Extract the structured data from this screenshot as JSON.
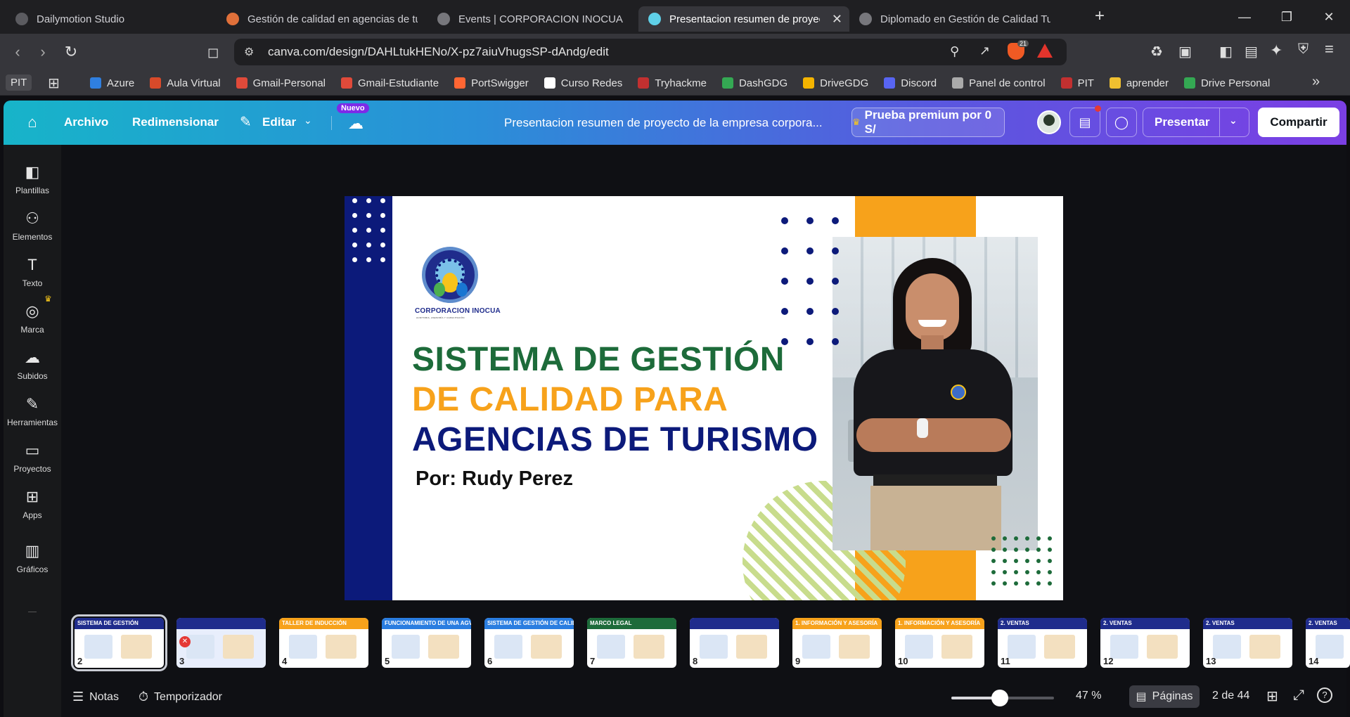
{
  "tabs": [
    {
      "title": "Dailymotion Studio",
      "color": "#5b5b60"
    },
    {
      "title": "Gestión de calidad en agencias de tur",
      "color": "#e0703a"
    },
    {
      "title": "Events | CORPORACION INOCUA",
      "color": "#77777c"
    },
    {
      "title": "Presentacion resumen de proyec",
      "color": "#5fd0e8",
      "active": true
    },
    {
      "title": "Diplomado en Gestión de Calidad Tur",
      "color": "#77777c"
    }
  ],
  "url": "canva.com/design/DAHLtukHENo/X-pz7aiuVhugsSP-dAndg/edit",
  "brave_badge": "21",
  "bookmarks": [
    {
      "label": "PIT",
      "color": "#4a4a4f"
    },
    {
      "label": "Azure",
      "color": "#2f7fe0"
    },
    {
      "label": "Aula Virtual",
      "color": "#d84a2a"
    },
    {
      "label": "Gmail-Personal",
      "color": "#e04a3a"
    },
    {
      "label": "Gmail-Estudiante",
      "color": "#e04a3a"
    },
    {
      "label": "PortSwigger",
      "color": "#ff6633"
    },
    {
      "label": "Curso Redes",
      "color": "#ffffff"
    },
    {
      "label": "Tryhackme",
      "color": "#c23030"
    },
    {
      "label": "DashGDG",
      "color": "#34a853"
    },
    {
      "label": "DriveGDG",
      "color": "#f4b400"
    },
    {
      "label": "Discord",
      "color": "#5865f2"
    },
    {
      "label": "Panel de control",
      "color": "#aaaaaa"
    },
    {
      "label": "PIT",
      "color": "#c23030"
    },
    {
      "label": "aprender",
      "color": "#f0c030"
    },
    {
      "label": "Drive Personal",
      "color": "#34a853"
    }
  ],
  "header": {
    "archivo": "Archivo",
    "redimensionar": "Redimensionar",
    "editar": "Editar",
    "nuevo": "Nuevo",
    "doc_title": "Presentacion resumen de proyecto de la empresa corpora...",
    "premium": "Prueba premium por 0 S/",
    "presentar": "Presentar",
    "compartir": "Compartir"
  },
  "sidebar": [
    {
      "label": "Plantillas",
      "icon": "◧"
    },
    {
      "label": "Elementos",
      "icon": "⚇"
    },
    {
      "label": "Texto",
      "icon": "T"
    },
    {
      "label": "Marca",
      "icon": "◎"
    },
    {
      "label": "Subidos",
      "icon": "☁"
    },
    {
      "label": "Herramientas",
      "icon": "✎"
    },
    {
      "label": "Proyectos",
      "icon": "▭"
    },
    {
      "label": "Apps",
      "icon": "⊞"
    },
    {
      "label": "Gráficos",
      "icon": "▥"
    }
  ],
  "slide": {
    "logo_name": "CORPORACION INOCUA",
    "logo_tagline": "AUDITORIA, ASESORÍA Y CAPACITACIÓN",
    "line1": "SISTEMA DE GESTIÓN",
    "line2": "DE CALIDAD PARA",
    "line3": "AGENCIAS DE TURISMO",
    "author": "Por: Rudy Perez",
    "colors": {
      "navy": "#0c1a7a",
      "green": "#1d6b3a",
      "orange": "#f7a21b",
      "dark": "#1f2c8c"
    }
  },
  "thumbnails": [
    {
      "n": "2",
      "title": "SISTEMA DE GESTIÓN",
      "bg": "#ffffff",
      "bar": "#1f2c8c"
    },
    {
      "n": "3",
      "title": "",
      "bg": "#e8eefc",
      "bar": "#1f2c8c"
    },
    {
      "n": "4",
      "title": "TALLER DE INDUCCIÓN",
      "bg": "#ffffff",
      "bar": "#f7a21b"
    },
    {
      "n": "5",
      "title": "FUNCIONAMIENTO DE UNA AGVT",
      "bg": "#ffffff",
      "bar": "#2a7de0"
    },
    {
      "n": "6",
      "title": "SISTEMA DE GESTIÓN DE CALIDAD",
      "bg": "#ffffff",
      "bar": "#2a7de0"
    },
    {
      "n": "7",
      "title": "MARCO LEGAL",
      "bg": "#ffffff",
      "bar": "#1d6b3a"
    },
    {
      "n": "8",
      "title": "",
      "bg": "#ffffff",
      "bar": "#1f2c8c"
    },
    {
      "n": "9",
      "title": "1. INFORMACIÓN Y ASESORÍA",
      "bg": "#ffffff",
      "bar": "#f7a21b"
    },
    {
      "n": "10",
      "title": "1. INFORMACIÓN Y ASESORÍA",
      "bg": "#ffffff",
      "bar": "#f7a21b"
    },
    {
      "n": "11",
      "title": "2. VENTAS",
      "bg": "#ffffff",
      "bar": "#1f2c8c"
    },
    {
      "n": "12",
      "title": "2. VENTAS",
      "bg": "#ffffff",
      "bar": "#1f2c8c"
    },
    {
      "n": "13",
      "title": "2. VENTAS",
      "bg": "#ffffff",
      "bar": "#1f2c8c"
    },
    {
      "n": "14",
      "title": "2. VENTAS",
      "bg": "#ffffff",
      "bar": "#1f2c8c"
    }
  ],
  "footer": {
    "notas": "Notas",
    "temporizador": "Temporizador",
    "zoom": "47 %",
    "zoom_level": 0.47,
    "paginas": "Páginas",
    "page_count": "2 de 44"
  }
}
